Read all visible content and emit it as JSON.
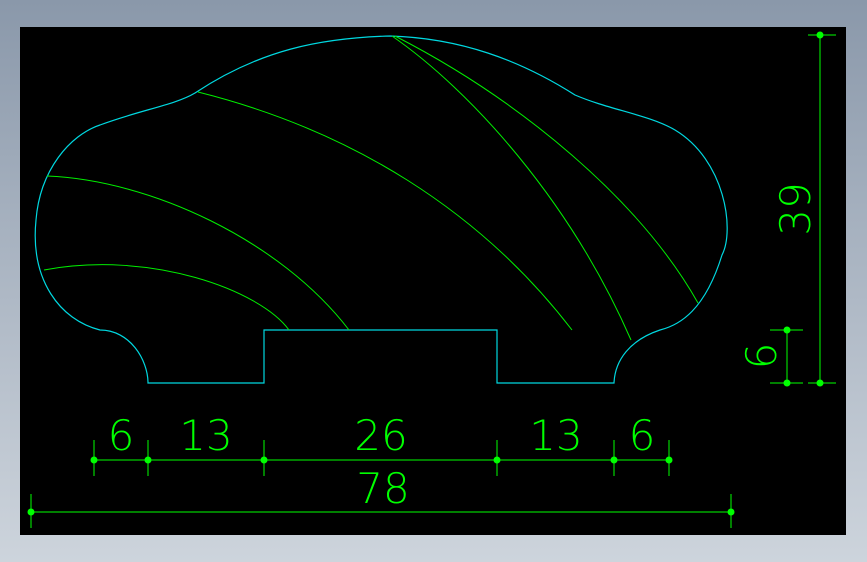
{
  "colors": {
    "background": "#000000",
    "profile": "#00d8e0",
    "grain": "#00ee00",
    "dimension": "#00ff00"
  },
  "dimensions": {
    "bottom_segments": [
      "6",
      "13",
      "26",
      "13",
      "6"
    ],
    "overall_width": "78",
    "overall_height": "39",
    "step_height": "6"
  }
}
